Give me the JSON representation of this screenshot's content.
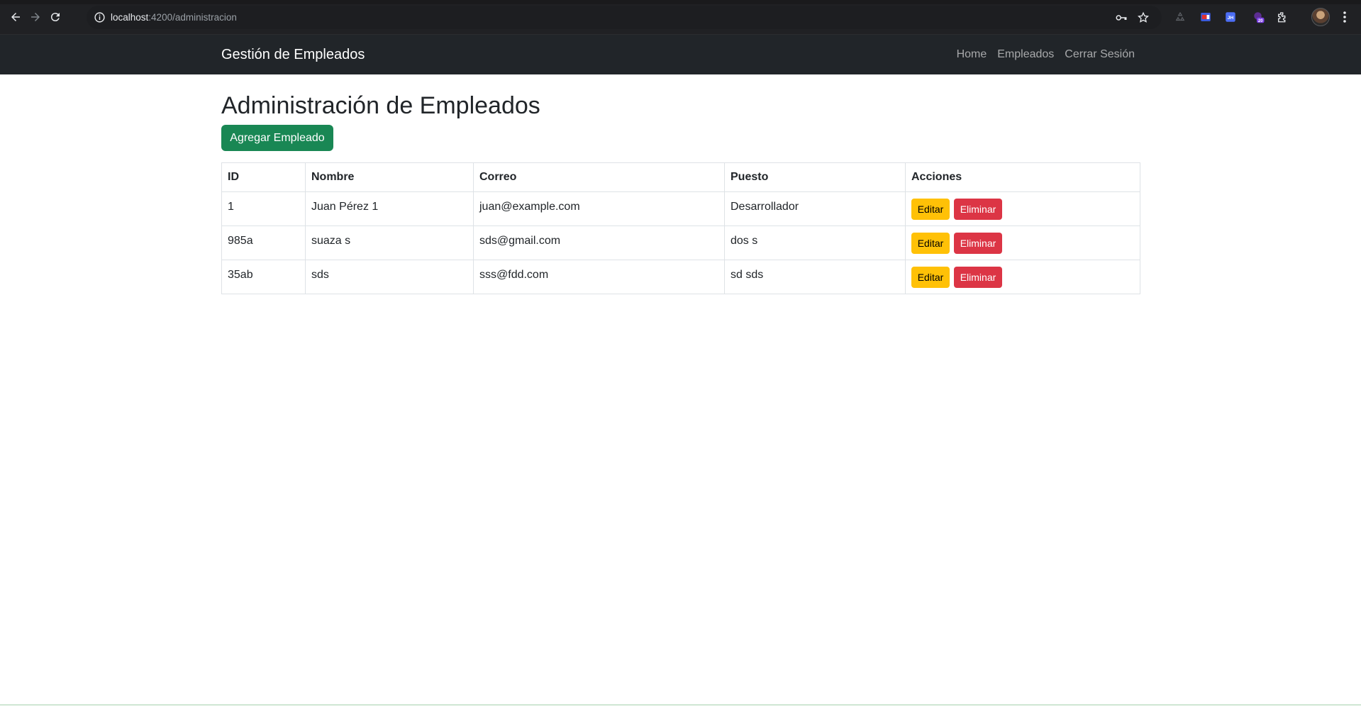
{
  "browser": {
    "url_host": "localhost",
    "url_path": ":4200/administracion",
    "extension_badge": "20",
    "extension_label": "JH"
  },
  "navbar": {
    "brand": "Gestión de Empleados",
    "links": [
      {
        "label": "Home"
      },
      {
        "label": "Empleados"
      },
      {
        "label": "Cerrar Sesión"
      }
    ]
  },
  "main": {
    "title": "Administración de Empleados",
    "add_button": "Agregar Empleado",
    "table": {
      "headers": [
        "ID",
        "Nombre",
        "Correo",
        "Puesto",
        "Acciones"
      ],
      "rows": [
        {
          "id": "1",
          "nombre": "Juan Pérez 1",
          "correo": "juan@example.com",
          "puesto": "Desarrollador",
          "edit": "Editar",
          "delete": "Eliminar"
        },
        {
          "id": "985a",
          "nombre": "suaza s",
          "correo": "sds@gmail.com",
          "puesto": "dos s",
          "edit": "Editar",
          "delete": "Eliminar"
        },
        {
          "id": "35ab",
          "nombre": "sds",
          "correo": "sss@fdd.com",
          "puesto": "sd sds",
          "edit": "Editar",
          "delete": "Eliminar"
        }
      ]
    }
  },
  "colors": {
    "navbar_bg": "#212529",
    "success": "#198754",
    "warning": "#ffc107",
    "danger": "#dc3545"
  }
}
